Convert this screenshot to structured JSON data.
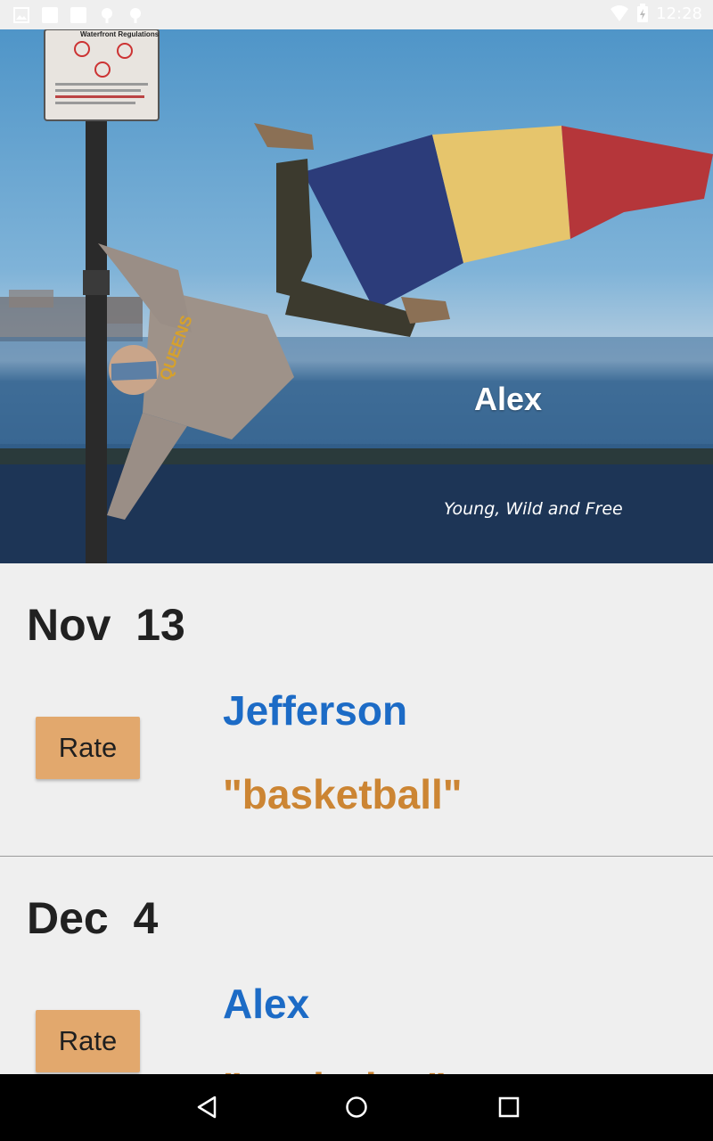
{
  "status_bar": {
    "time": "12:28",
    "left_icons": [
      "image-icon",
      "square-icon",
      "square-icon",
      "android-icon",
      "android-icon"
    ],
    "right_icons": [
      "wifi-icon",
      "battery-icon"
    ]
  },
  "hero": {
    "title": "Alex",
    "subtitle": "Young, Wild and Free",
    "sign_title": "Waterfront Regulations",
    "sweater_text": "QUEENS"
  },
  "entries": [
    {
      "date": "Nov  13",
      "rate_label": "Rate",
      "name": "Jefferson",
      "quote": "\"basketball\""
    },
    {
      "date": "Dec  4",
      "rate_label": "Rate",
      "name": "Alex",
      "quote": "\"exploring\""
    }
  ],
  "nav": {
    "icons": [
      "back-icon",
      "home-icon",
      "recents-icon"
    ]
  },
  "colors": {
    "status_bar": "#efefef",
    "background": "#eeeeee",
    "name": "#1c6bc6",
    "quote": "#cc8533",
    "rate_button": "#e2a86d",
    "nav_bar": "#000000"
  }
}
